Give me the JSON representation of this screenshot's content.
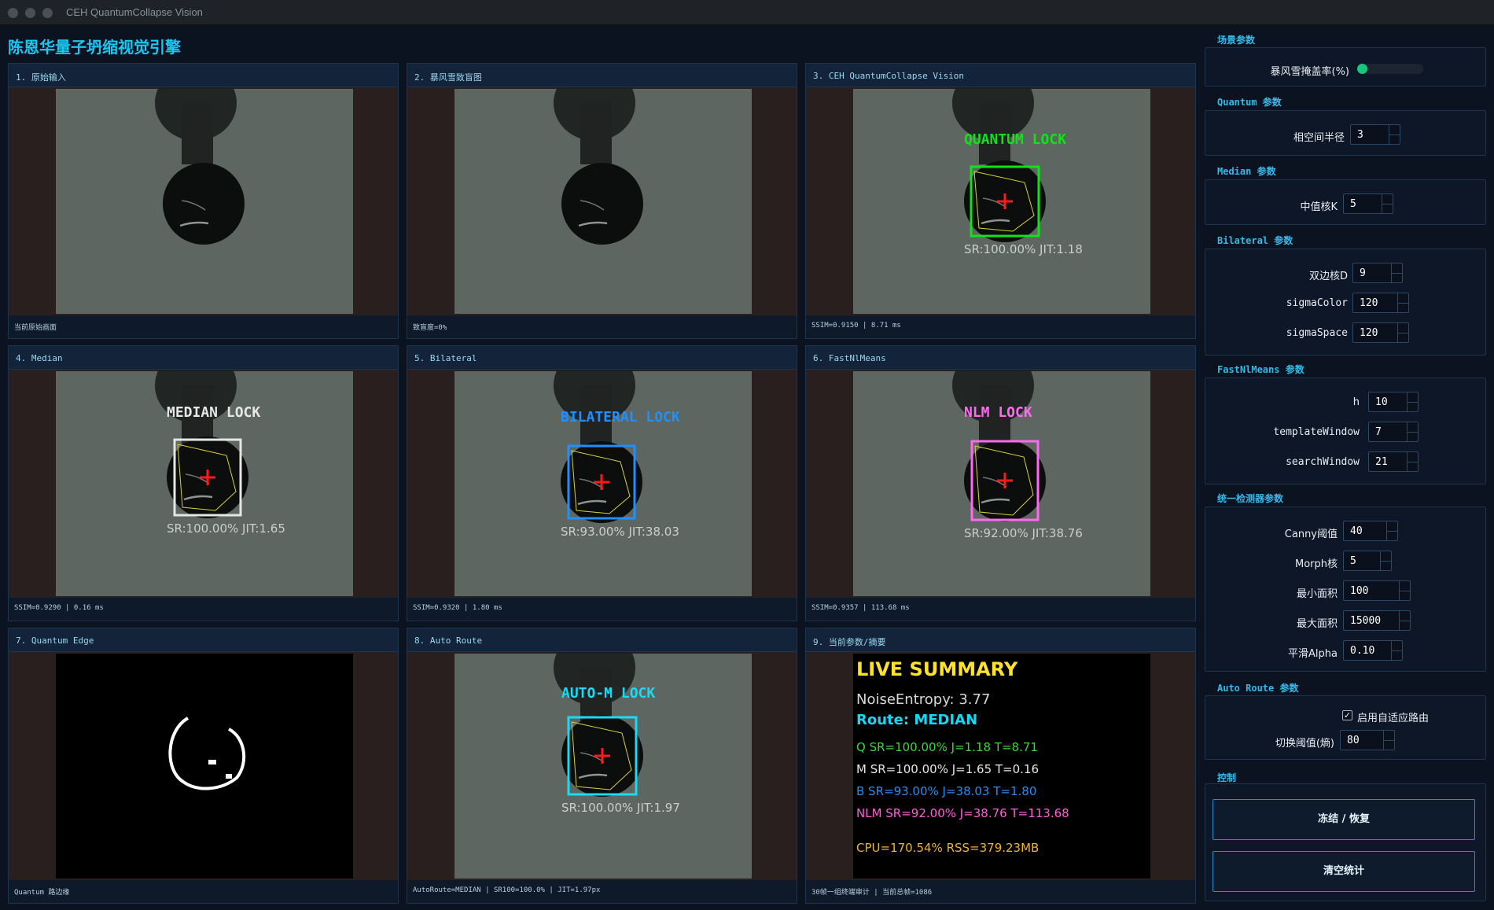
{
  "window": {
    "title": "CEH QuantumCollapse Vision"
  },
  "app": {
    "title": "陈恩华量子坍缩视觉引擎"
  },
  "panels": [
    {
      "title": "1. 原始输入",
      "status": "当前原始画面"
    },
    {
      "title": "2. 暴风雪致盲图",
      "status": "致盲度=0%"
    },
    {
      "title": "3. CEH QuantumCollapse Vision",
      "status": "SSIM=0.9150 | 8.71 ms",
      "lock_label": "QUANTUM LOCK",
      "stats": "SR:100.00%   JIT:1.18",
      "color": "#12e21a"
    },
    {
      "title": "4. Median",
      "status": "SSIM=0.9290 | 0.16 ms",
      "lock_label": "MEDIAN LOCK",
      "stats": "SR:100.00%   JIT:1.65",
      "color": "#e6e6e6"
    },
    {
      "title": "5. Bilateral",
      "status": "SSIM=0.9320 | 1.80 ms",
      "lock_label": "BILATERAL LOCK",
      "stats": "SR:93.00%   JIT:38.03",
      "color": "#1e90ff"
    },
    {
      "title": "6. FastNlMeans",
      "status": "SSIM=0.9357 | 113.68 ms",
      "lock_label": "NLM LOCK",
      "stats": "SR:92.00%   JIT:38.76",
      "color": "#ff6af0"
    },
    {
      "title": "7. Quantum Edge",
      "status": "Quantum 路边缘"
    },
    {
      "title": "8. Auto Route",
      "status": "AutoRoute=MEDIAN | SR100=100.0% | JIT=1.97px",
      "lock_label": "AUTO-M LOCK",
      "stats": "SR:100.00%   JIT:1.97",
      "color": "#18dcf5"
    },
    {
      "title": "9. 当前参数/摘要",
      "status": "30帧一组终端审计 | 当前总帧=1086"
    }
  ],
  "summary": {
    "heading": "LIVE SUMMARY",
    "entropy": "NoiseEntropy: 3.77",
    "route": "Route: MEDIAN",
    "lines": [
      {
        "text": "Q   SR=100.00% J=1.18 T=8.71",
        "color": "#3fd43a"
      },
      {
        "text": "M   SR=100.00% J=1.65 T=0.16",
        "color": "#e6e6e6"
      },
      {
        "text": "B   SR=93.00% J=38.03 T=1.80",
        "color": "#2b8cf0"
      },
      {
        "text": "NLM SR=92.00% J=38.76 T=113.68",
        "color": "#ff5fd6"
      }
    ],
    "resources": "CPU=170.54% RSS=379.23MB"
  },
  "controls": {
    "scene": {
      "title": "场景参数",
      "blizzard_label": "暴风雪掩盖率(%)",
      "blizzard_value": 0
    },
    "quantum": {
      "title": "Quantum 参数",
      "radius_label": "相空间半径",
      "radius_value": "3"
    },
    "median": {
      "title": "Median 参数",
      "k_label": "中值核K",
      "k_value": "5"
    },
    "bilateral": {
      "title": "Bilateral 参数",
      "d_label": "双边核D",
      "d_value": "9",
      "color_label": "sigmaColor",
      "color_value": "120",
      "space_label": "sigmaSpace",
      "space_value": "120"
    },
    "nlm": {
      "title": "FastNlMeans 参数",
      "h_label": "h",
      "h_value": "10",
      "tw_label": "templateWindow",
      "tw_value": "7",
      "sw_label": "searchWindow",
      "sw_value": "21"
    },
    "detector": {
      "title": "统一检测器参数",
      "canny_label": "Canny阈值",
      "canny_value": "40",
      "morph_label": "Morph核",
      "morph_value": "5",
      "min_label": "最小面积",
      "min_value": "100",
      "max_label": "最大面积",
      "max_value": "15000",
      "alpha_label": "平滑Alpha",
      "alpha_value": "0.10"
    },
    "auto": {
      "title": "Auto Route 参数",
      "check_mark": "✓",
      "enable_label": "启用自适应路由",
      "switch_label": "切换阈值(熵)",
      "switch_value": "80"
    },
    "control": {
      "title": "控制",
      "freeze_label": "冻结 / 恢复",
      "clear_label": "清空统计"
    }
  }
}
